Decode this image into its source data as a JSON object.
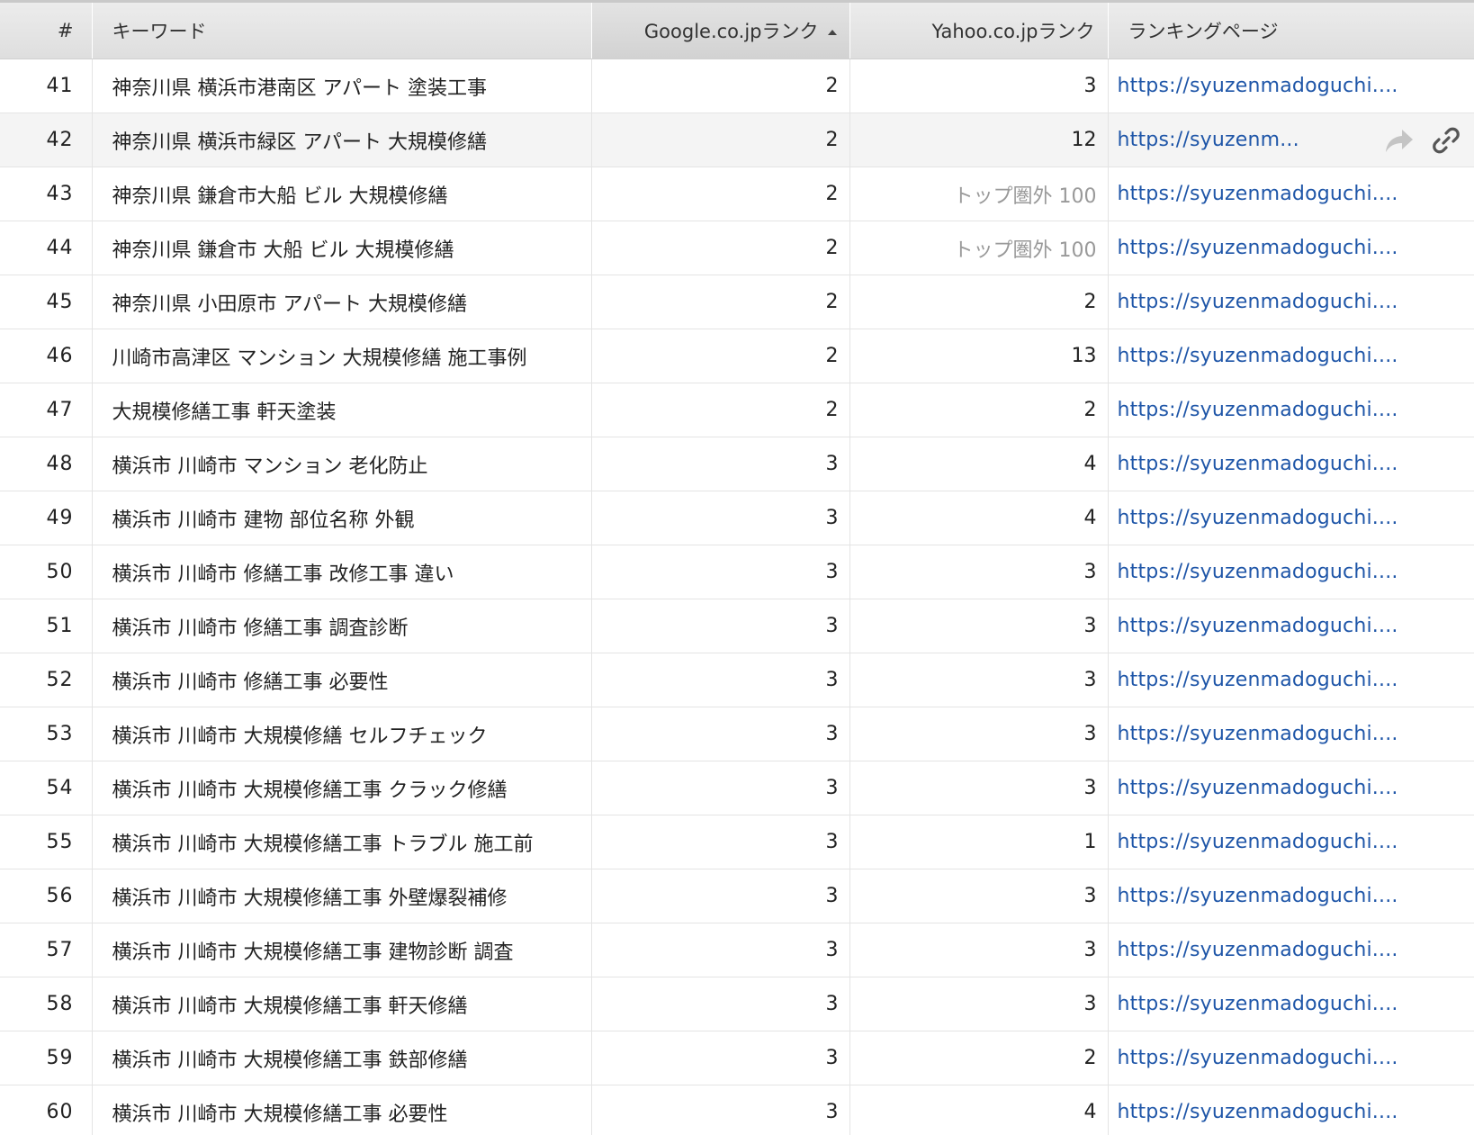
{
  "table": {
    "columns": {
      "index": "#",
      "keyword": "キーワード",
      "google": "Google.co.jpランク",
      "yahoo": "Yahoo.co.jpランク",
      "page": "ランキングページ"
    },
    "sort": {
      "column": "google",
      "direction": "asc"
    },
    "hover_row": 1,
    "rows": [
      {
        "n": "41",
        "kw": "神奈川県 横浜市港南区 アパート 塗装工事",
        "g": "2",
        "y": "3",
        "url": "https://syuzenmadoguchi...."
      },
      {
        "n": "42",
        "kw": "神奈川県 横浜市緑区 アパート 大規模修繕",
        "g": "2",
        "y": "12",
        "url": "https://syuzenm..."
      },
      {
        "n": "43",
        "kw": "神奈川県 鎌倉市大船 ビル 大規模修繕",
        "g": "2",
        "y": "トップ圏外 100",
        "url": "https://syuzenmadoguchi...."
      },
      {
        "n": "44",
        "kw": "神奈川県 鎌倉市 大船 ビル 大規模修繕",
        "g": "2",
        "y": "トップ圏外 100",
        "url": "https://syuzenmadoguchi...."
      },
      {
        "n": "45",
        "kw": "神奈川県 小田原市 アパート 大規模修繕",
        "g": "2",
        "y": "2",
        "url": "https://syuzenmadoguchi...."
      },
      {
        "n": "46",
        "kw": "川崎市高津区 マンション 大規模修繕 施工事例",
        "g": "2",
        "y": "13",
        "url": "https://syuzenmadoguchi...."
      },
      {
        "n": "47",
        "kw": "大規模修繕工事 軒天塗装",
        "g": "2",
        "y": "2",
        "url": "https://syuzenmadoguchi...."
      },
      {
        "n": "48",
        "kw": "横浜市 川崎市 マンション 老化防止",
        "g": "3",
        "y": "4",
        "url": "https://syuzenmadoguchi...."
      },
      {
        "n": "49",
        "kw": "横浜市 川崎市 建物 部位名称 外観",
        "g": "3",
        "y": "4",
        "url": "https://syuzenmadoguchi...."
      },
      {
        "n": "50",
        "kw": "横浜市 川崎市 修繕工事 改修工事 違い",
        "g": "3",
        "y": "3",
        "url": "https://syuzenmadoguchi...."
      },
      {
        "n": "51",
        "kw": "横浜市 川崎市 修繕工事 調査診断",
        "g": "3",
        "y": "3",
        "url": "https://syuzenmadoguchi...."
      },
      {
        "n": "52",
        "kw": "横浜市 川崎市 修繕工事 必要性",
        "g": "3",
        "y": "3",
        "url": "https://syuzenmadoguchi...."
      },
      {
        "n": "53",
        "kw": "横浜市 川崎市 大規模修繕 セルフチェック",
        "g": "3",
        "y": "3",
        "url": "https://syuzenmadoguchi...."
      },
      {
        "n": "54",
        "kw": "横浜市 川崎市 大規模修繕工事 クラック修繕",
        "g": "3",
        "y": "3",
        "url": "https://syuzenmadoguchi...."
      },
      {
        "n": "55",
        "kw": "横浜市 川崎市 大規模修繕工事 トラブル 施工前",
        "g": "3",
        "y": "1",
        "url": "https://syuzenmadoguchi...."
      },
      {
        "n": "56",
        "kw": "横浜市 川崎市 大規模修繕工事 外壁爆裂補修",
        "g": "3",
        "y": "3",
        "url": "https://syuzenmadoguchi...."
      },
      {
        "n": "57",
        "kw": "横浜市 川崎市 大規模修繕工事 建物診断 調査",
        "g": "3",
        "y": "3",
        "url": "https://syuzenmadoguchi...."
      },
      {
        "n": "58",
        "kw": "横浜市 川崎市 大規模修繕工事 軒天修繕",
        "g": "3",
        "y": "3",
        "url": "https://syuzenmadoguchi...."
      },
      {
        "n": "59",
        "kw": "横浜市 川崎市 大規模修繕工事 鉄部修繕",
        "g": "3",
        "y": "2",
        "url": "https://syuzenmadoguchi...."
      },
      {
        "n": "60",
        "kw": "横浜市 川崎市 大規模修繕工事 必要性",
        "g": "3",
        "y": "4",
        "url": "https://syuzenmadoguchi...."
      }
    ]
  },
  "icons": {
    "share": "share-arrow-icon",
    "link": "chain-link-icon"
  },
  "colors": {
    "link": "#1f56a8",
    "header_bg": "#e2e2e2",
    "muted": "#999999"
  }
}
